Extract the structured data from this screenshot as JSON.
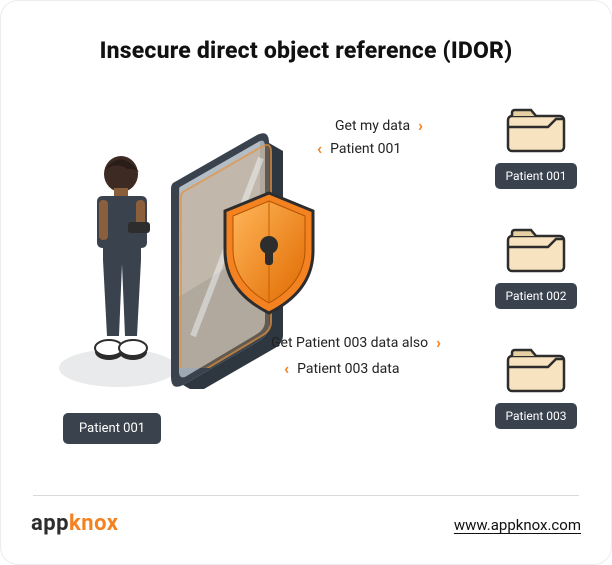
{
  "title": "Insecure direct object reference (IDOR)",
  "logo_pre": "app",
  "logo_knox": "knox",
  "site_url": "www.appknox.com",
  "actor": {
    "label": "Patient 001"
  },
  "requests": {
    "top_out": "Get my data",
    "top_in": "Patient 001",
    "bot_out": "Get Patient 003 data also",
    "bot_in": "Patient 003 data"
  },
  "folders": [
    {
      "label": "Patient 001"
    },
    {
      "label": "Patient 002"
    },
    {
      "label": "Patient 003"
    }
  ],
  "glyph": {
    "right": "›",
    "left": "‹"
  }
}
